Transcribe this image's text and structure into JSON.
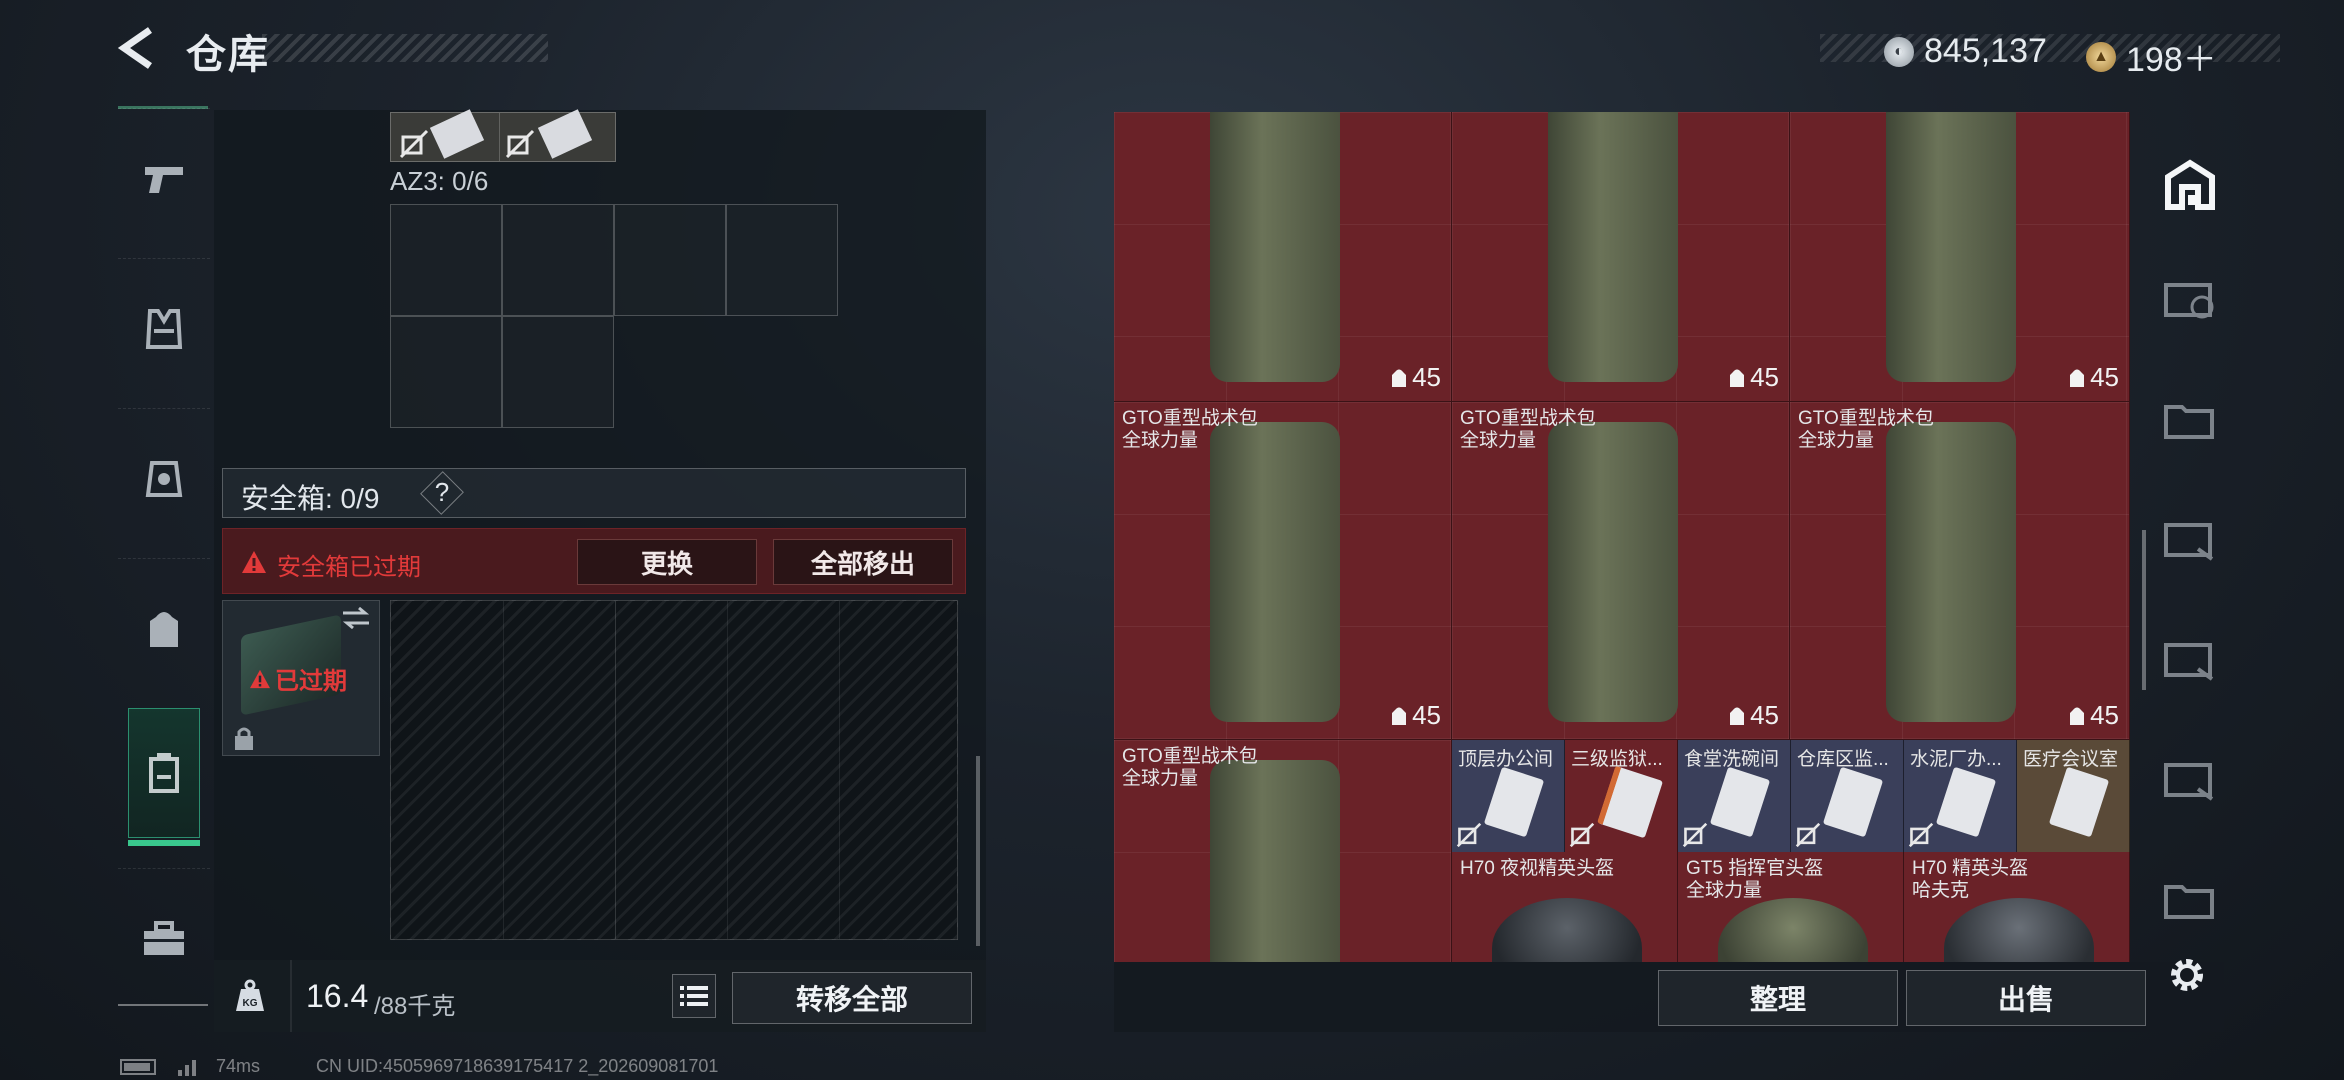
{
  "header": {
    "title": "仓库",
    "currency_silver": "845,137",
    "currency_gold": "198＋"
  },
  "left_nav": [
    {
      "icon": "pistol-icon"
    },
    {
      "icon": "vest-icon"
    },
    {
      "icon": "armor-plate-icon"
    },
    {
      "icon": "backpack-icon"
    },
    {
      "icon": "safe-box-icon"
    },
    {
      "icon": "toolbox-icon"
    }
  ],
  "container": {
    "az3_label": "AZ3: 0/6"
  },
  "safe_box": {
    "label": "安全箱: 0/9",
    "help": "?",
    "expired_alert": "安全箱已过期",
    "replace_button": "更换",
    "move_all_out_button": "全部移出",
    "slot_status": "已过期"
  },
  "weight": {
    "current": "16.4",
    "max": "/88千克",
    "transfer_all_button": "转移全部"
  },
  "inventory": {
    "backpacks": [
      {
        "name_line1": "",
        "name_line2": "",
        "capacity": "45"
      },
      {
        "name_line1": "",
        "name_line2": "",
        "capacity": "45"
      },
      {
        "name_line1": "",
        "name_line2": "",
        "capacity": "45"
      },
      {
        "name_line1": "GTO重型战术包",
        "name_line2": "全球力量",
        "capacity": "45"
      },
      {
        "name_line1": "GTO重型战术包",
        "name_line2": "全球力量",
        "capacity": "45"
      },
      {
        "name_line1": "GTO重型战术包",
        "name_line2": "全球力量",
        "capacity": "45"
      },
      {
        "name_line1": "GTO重型战术包",
        "name_line2": "全球力量",
        "capacity": ""
      }
    ],
    "keycards": [
      {
        "name": "顶层办公间"
      },
      {
        "name": "三级监狱..."
      },
      {
        "name": "食堂洗碗间"
      },
      {
        "name": "仓库区监..."
      },
      {
        "name": "水泥厂办..."
      },
      {
        "name": "医疗会议室"
      }
    ],
    "helmets": [
      {
        "name_line1": "H70 夜视精英头盔",
        "name_line2": ""
      },
      {
        "name_line1": "GT5 指挥官头盔",
        "name_line2": "全球力量"
      },
      {
        "name_line1": "H70 精英头盔",
        "name_line2": "哈夫克"
      }
    ],
    "sort_button": "整理",
    "sell_button": "出售"
  },
  "status": {
    "ping": "74ms",
    "uid": "CN UID:4505969718639175417 2_202609081701"
  },
  "colors": {
    "accent": "#39c78d",
    "item_rarity_red": "#6a2228",
    "keycard_bg": "#3a3f5a",
    "alert": "#e23a3a"
  }
}
